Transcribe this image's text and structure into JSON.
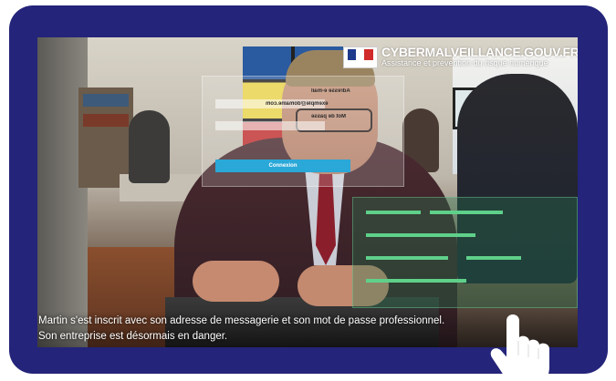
{
  "brand": {
    "name": "CYBERMALVEILLANCE.GOUV.FR",
    "tagline": "Assistance et prévention du risque numérique"
  },
  "holo": {
    "email_label": "Adresse e-mail",
    "email_value": "exemple@domaine.com",
    "password_label": "Mot de passe",
    "button_label": "Connexion"
  },
  "caption": {
    "line1": "Martin s'est inscrit avec son adresse de messagerie et son mot de passe professionnel.",
    "line2": "Son entreprise est désormais en danger."
  },
  "colors": {
    "frame": "#24247a",
    "button": "#2aa8d8"
  },
  "icons": {
    "cursor": "hand-pointer-icon",
    "logo": "french-flag-icon"
  }
}
